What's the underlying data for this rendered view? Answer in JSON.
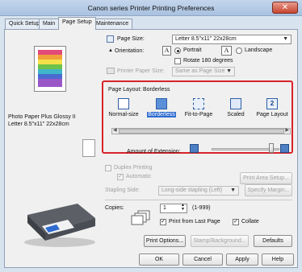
{
  "window": {
    "title": "Canon       series Printer Printing Preferences",
    "close_glyph": "✕"
  },
  "tabs": [
    "Quick Setup",
    "Main",
    "Page Setup",
    "Maintenance"
  ],
  "preview": {
    "media_line1": "Photo Paper Plus Glossy II",
    "media_line2": "Letter 8.5\"x11\" 22x28cm"
  },
  "page_size": {
    "label": "Page Size:",
    "value": "Letter 8.5\"x11\" 22x28cm"
  },
  "orientation": {
    "label": "Orientation:",
    "portrait": "Portrait",
    "landscape": "Landscape",
    "rotate": "Rotate 180 degrees",
    "selected": "Portrait"
  },
  "printer_paper_size": {
    "label": "Printer Paper Size:",
    "value": "Same as Page Size"
  },
  "page_layout": {
    "label": "Page Layout:",
    "current": "Borderless",
    "items": [
      "Normal-size",
      "Borderless",
      "Fit-to-Page",
      "Scaled",
      "Page Layout"
    ],
    "selected_index": 1
  },
  "extension": {
    "label": "Amount of Extension:",
    "level": 0.88
  },
  "duplex": {
    "label": "Duplex Printing",
    "automatic": "Automatic",
    "area_button": "Print Area Setup..."
  },
  "stapling": {
    "label": "Stapling Side:",
    "value": "Long-side stapling (Left)",
    "margin_button": "Specify Margin..."
  },
  "copies": {
    "label": "Copies:",
    "value": "1",
    "range": "(1-999)",
    "from_last": "Print from Last Page",
    "collate": "Collate"
  },
  "actions": {
    "print_options": "Print Options...",
    "stamp": "Stamp/Background...",
    "defaults": "Defaults"
  },
  "dialog": {
    "ok": "OK",
    "cancel": "Cancel",
    "apply": "Apply",
    "help": "Help"
  },
  "colors": {
    "highlight": "#d8232a",
    "selection": "#2f6bd0"
  }
}
